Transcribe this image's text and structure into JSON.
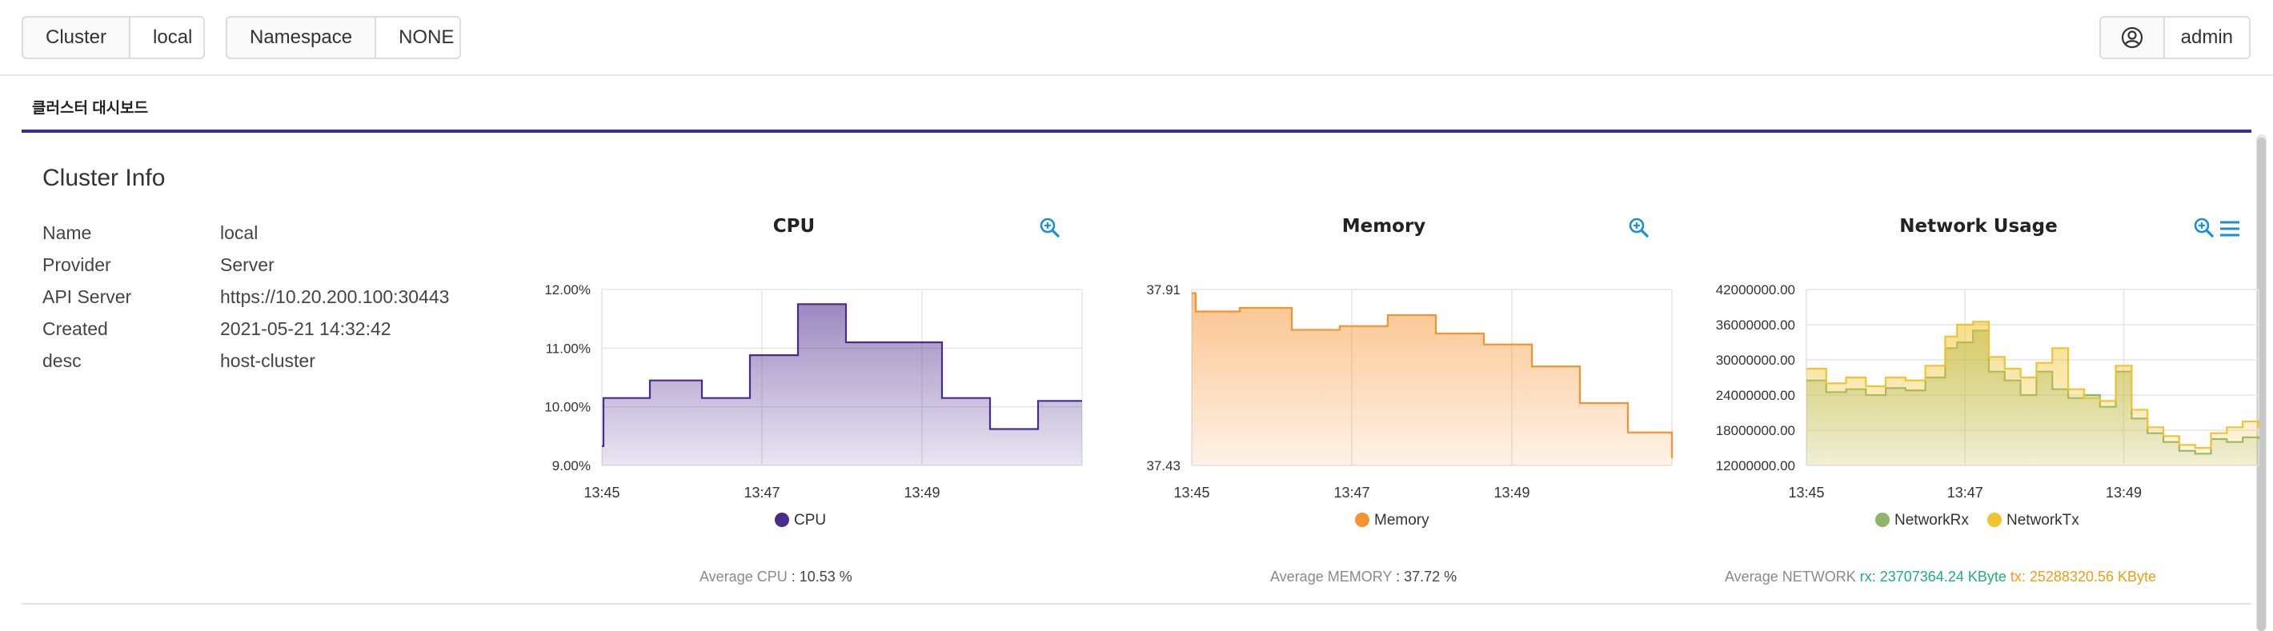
{
  "header": {
    "cluster_label": "Cluster",
    "cluster_value": "local",
    "namespace_label": "Namespace",
    "namespace_value": "NONE",
    "user_name": "admin",
    "user_icon": "user-circle-icon"
  },
  "tabs": [
    {
      "label": "클러스터 대시보드"
    }
  ],
  "panel": {
    "title": "Cluster Info",
    "info": [
      {
        "key": "Name",
        "value": "local"
      },
      {
        "key": "Provider",
        "value": "Server"
      },
      {
        "key": "API Server",
        "value": "https://10.20.200.100:30443"
      },
      {
        "key": "Created",
        "value": "2021-05-21 14:32:42"
      },
      {
        "key": "desc",
        "value": "host-cluster"
      }
    ]
  },
  "summaries": {
    "cpu_prefix": "Average CPU",
    "cpu_value": ": 10.53 %",
    "memory_prefix": "Average MEMORY",
    "memory_value": ": 37.72 %",
    "network_prefix": "Average NETWORK",
    "network_rx": "rx: 23707364.24 KByte",
    "network_tx": "tx: 25288320.56 KByte"
  },
  "chart_data": [
    {
      "type": "area",
      "title": "CPU",
      "x_ticks": [
        "13:45",
        "13:47",
        "13:49"
      ],
      "y_ticks": [
        "12.00%",
        "11.00%",
        "10.00%",
        "9.00%"
      ],
      "ylim": [
        9.0,
        12.0
      ],
      "xlim_minutes": [
        0,
        6.0
      ],
      "legend_position": "bottom",
      "series": [
        {
          "name": "CPU",
          "color": "#4b2a8e",
          "x": [
            0,
            0.02,
            0.6,
            1.25,
            1.85,
            2.45,
            3.05,
            3.7,
            4.25,
            4.85,
            5.45,
            6.0
          ],
          "y": [
            9.33,
            10.15,
            10.45,
            10.15,
            10.88,
            11.75,
            11.1,
            11.1,
            10.15,
            9.62,
            10.1,
            10.1
          ]
        }
      ]
    },
    {
      "type": "area",
      "title": "Memory",
      "x_ticks": [
        "13:45",
        "13:47",
        "13:49"
      ],
      "y_ticks": [
        "37.91",
        "37.43"
      ],
      "ylim": [
        37.43,
        37.91
      ],
      "xlim_minutes": [
        0,
        6.0
      ],
      "legend_position": "bottom",
      "series": [
        {
          "name": "Memory",
          "color": "#f7922f",
          "x": [
            0,
            0.05,
            0.6,
            1.25,
            1.85,
            2.45,
            3.05,
            3.65,
            4.25,
            4.85,
            5.45,
            6.0
          ],
          "y": [
            37.9,
            37.85,
            37.86,
            37.8,
            37.81,
            37.84,
            37.79,
            37.76,
            37.7,
            37.6,
            37.52,
            37.45
          ]
        }
      ]
    },
    {
      "type": "area",
      "title": "Network Usage",
      "x_ticks": [
        "13:45",
        "13:47",
        "13:49"
      ],
      "y_ticks": [
        "42000000.00",
        "36000000.00",
        "30000000.00",
        "24000000.00",
        "18000000.00",
        "12000000.00"
      ],
      "ylim": [
        12000000,
        42000000
      ],
      "xlim_minutes": [
        0,
        5.7
      ],
      "legend_position": "bottom",
      "series": [
        {
          "name": "NetworkRx",
          "color": "#8ab56b",
          "x": [
            0,
            0.25,
            0.5,
            0.75,
            1.0,
            1.25,
            1.5,
            1.75,
            1.9,
            2.1,
            2.3,
            2.5,
            2.7,
            2.9,
            3.1,
            3.3,
            3.5,
            3.7,
            3.9,
            4.1,
            4.3,
            4.5,
            4.7,
            4.9,
            5.1,
            5.3,
            5.5,
            5.7
          ],
          "y": [
            26500000,
            24500000,
            25000000,
            24000000,
            25200000,
            24800000,
            27000000,
            32000000,
            33000000,
            35000000,
            28000000,
            26500000,
            24000000,
            28000000,
            25000000,
            23500000,
            24000000,
            22000000,
            28000000,
            20000000,
            17500000,
            16000000,
            14500000,
            14000000,
            16500000,
            16000000,
            16800000,
            16500000
          ]
        },
        {
          "name": "NetworkTx",
          "color": "#f0c330",
          "x": [
            0,
            0.25,
            0.5,
            0.75,
            1.0,
            1.25,
            1.5,
            1.75,
            1.9,
            2.1,
            2.3,
            2.5,
            2.7,
            2.9,
            3.1,
            3.3,
            3.5,
            3.7,
            3.9,
            4.1,
            4.3,
            4.5,
            4.7,
            4.9,
            5.1,
            5.3,
            5.5,
            5.7
          ],
          "y": [
            28500000,
            26000000,
            27000000,
            25500000,
            27000000,
            26500000,
            29000000,
            34000000,
            36000000,
            36500000,
            30500000,
            28500000,
            27000000,
            29500000,
            32000000,
            25000000,
            23500000,
            23000000,
            29000000,
            21500000,
            18500000,
            17000000,
            15500000,
            15000000,
            17500000,
            18500000,
            19500000,
            18500000
          ]
        }
      ]
    }
  ]
}
